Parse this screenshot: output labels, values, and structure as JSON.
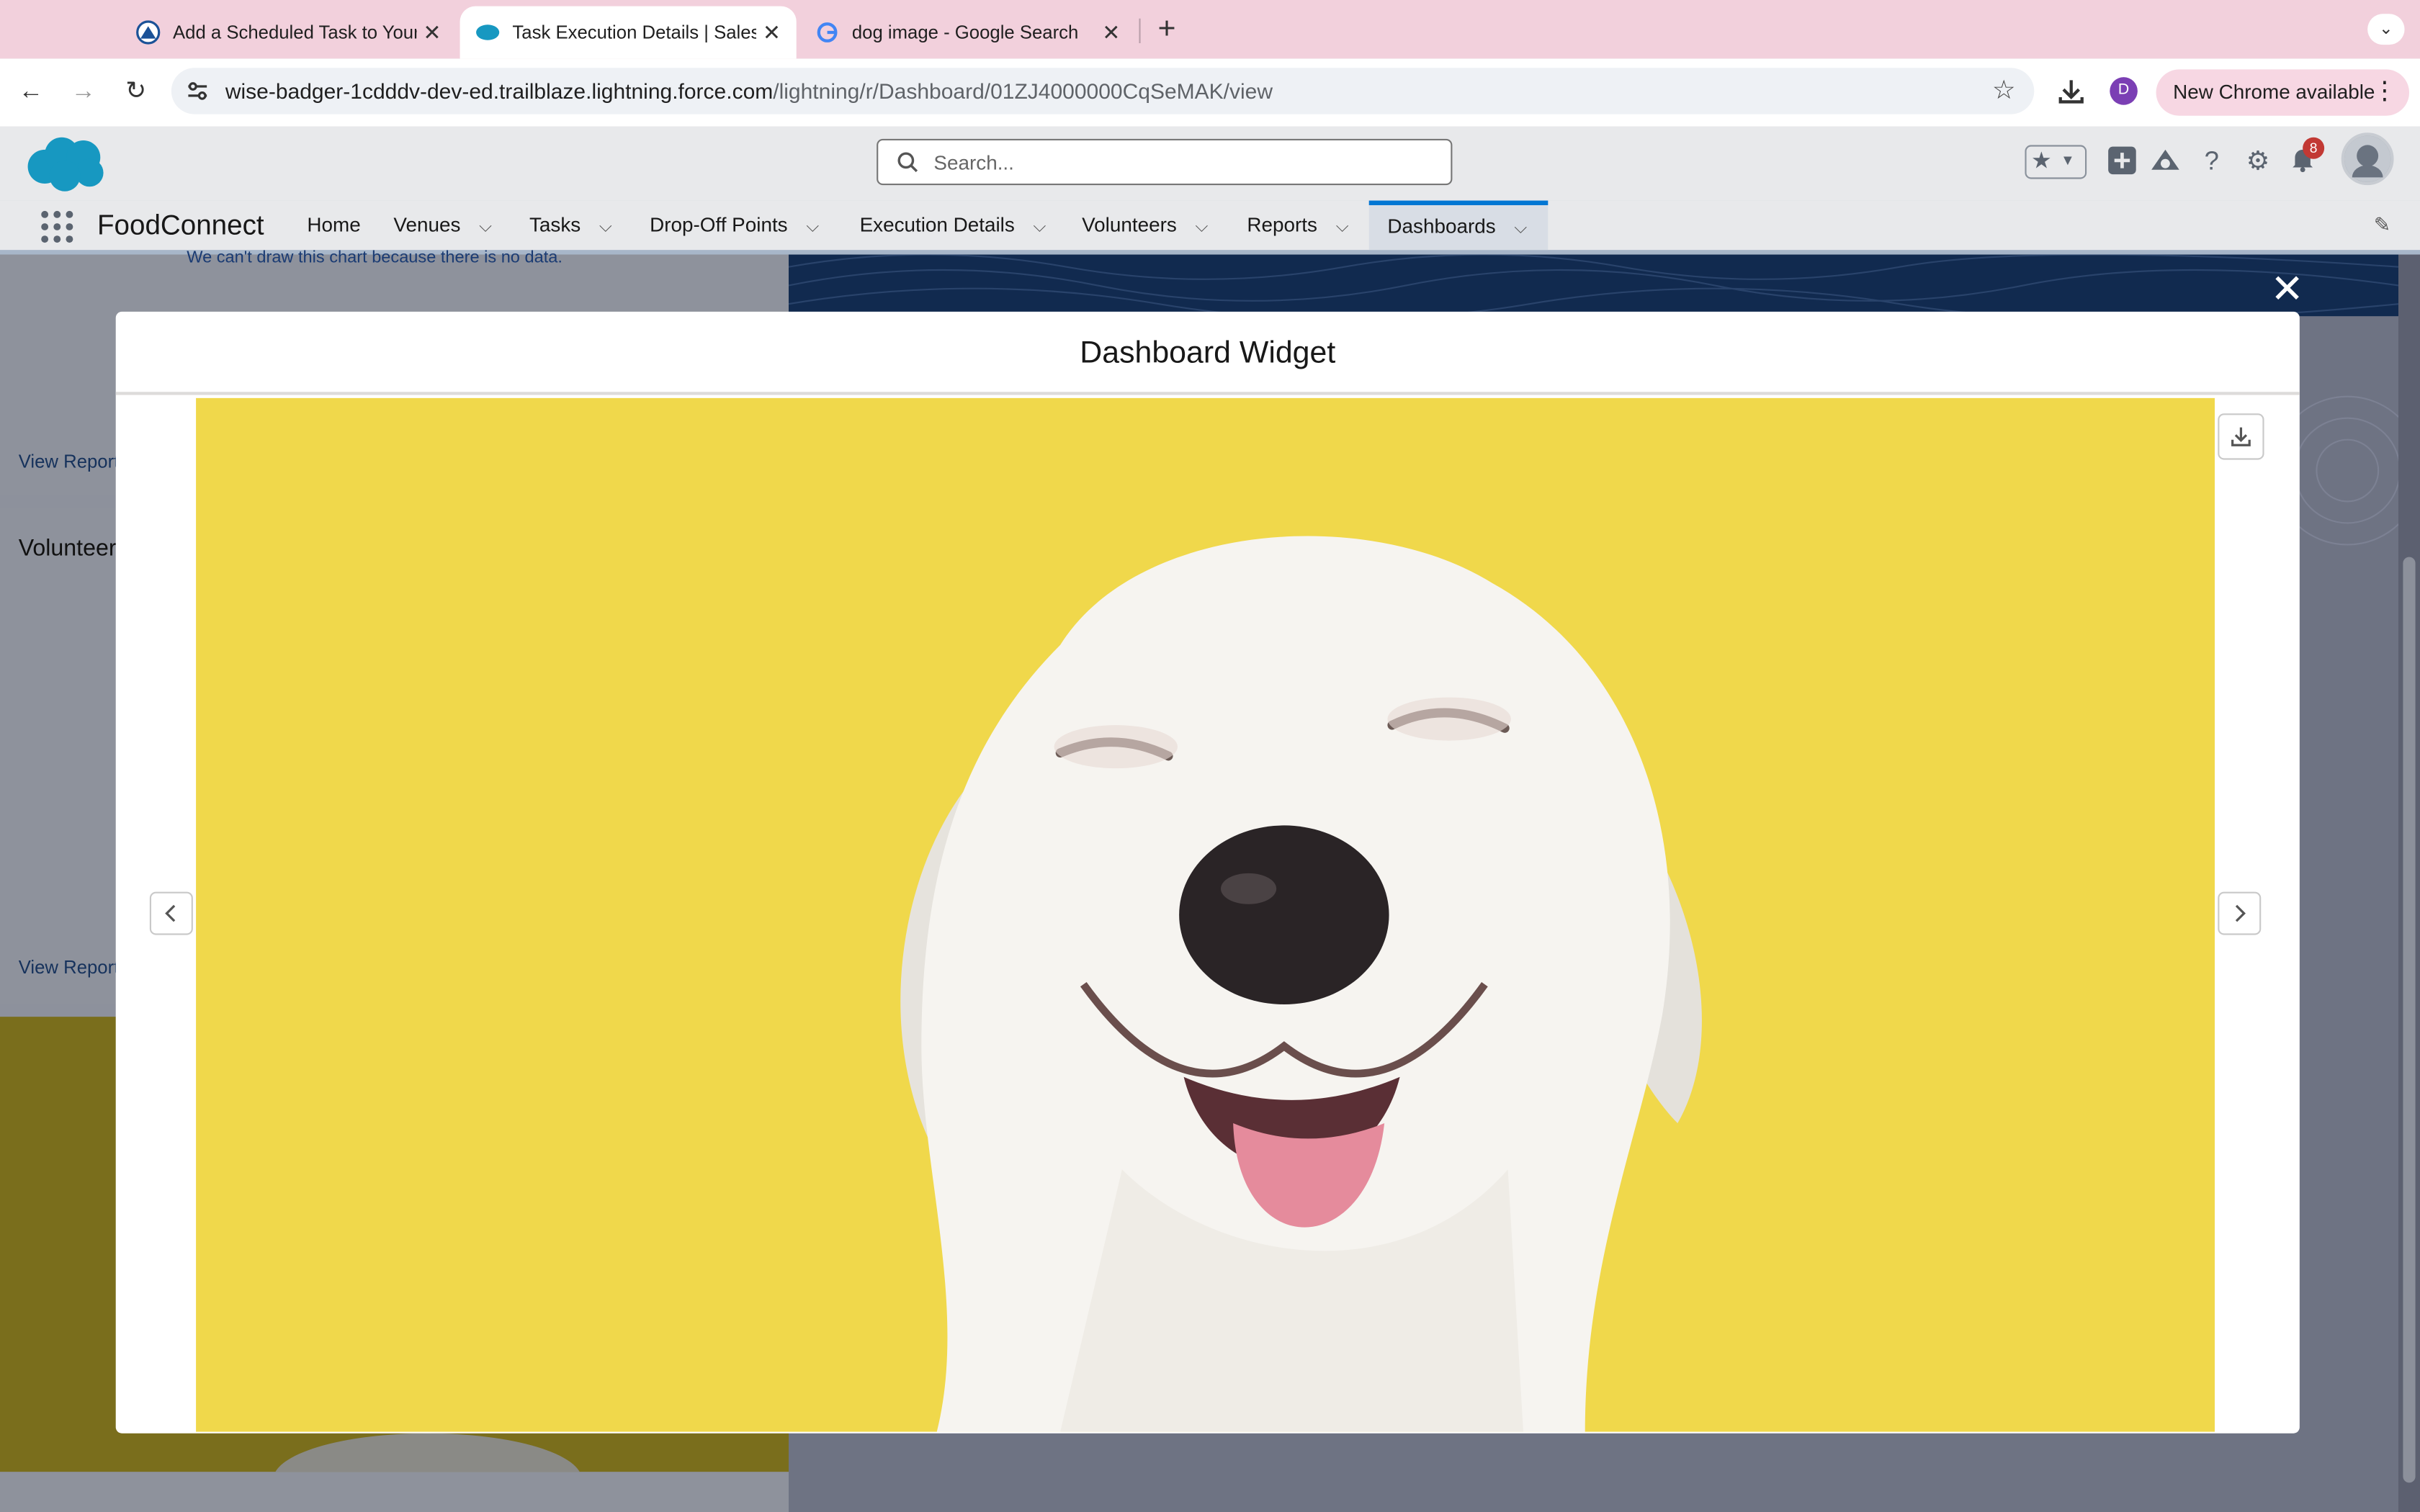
{
  "browser": {
    "tabs": [
      {
        "title": "Add a Scheduled Task to Your",
        "active": false
      },
      {
        "title": "Task Execution Details | Sales",
        "active": true
      },
      {
        "title": "dog image - Google Search",
        "active": false
      }
    ],
    "url_host": "wise-badger-1cdddv-dev-ed.trailblaze.lightning.force.com",
    "url_path": "/lightning/r/Dashboard/01ZJ4000000CqSeMAK/view",
    "profile_initial": "D",
    "update_label": "New Chrome available"
  },
  "salesforce": {
    "search_placeholder": "Search...",
    "notification_count": "8",
    "app_name": "FoodConnect",
    "nav": [
      {
        "label": "Home",
        "has_menu": false
      },
      {
        "label": "Venues",
        "has_menu": true
      },
      {
        "label": "Tasks",
        "has_menu": true
      },
      {
        "label": "Drop-Off Points",
        "has_menu": true
      },
      {
        "label": "Execution Details",
        "has_menu": true
      },
      {
        "label": "Volunteers",
        "has_menu": true
      },
      {
        "label": "Reports",
        "has_menu": true
      },
      {
        "label": "Dashboards",
        "has_menu": true,
        "active": true
      }
    ]
  },
  "dashboard": {
    "no_data_message": "We can't draw this chart because there is no data.",
    "view_report_1": "View Report",
    "card2_title": "Volunteer",
    "view_report_2": "View Report"
  },
  "modal": {
    "title": "Dashboard Widget",
    "image_description": "smiling white puppy on yellow background"
  },
  "colors": {
    "accent": "#0176d3",
    "image_bg": "#f0d84b",
    "tab_strip": "#f2d0dc"
  }
}
